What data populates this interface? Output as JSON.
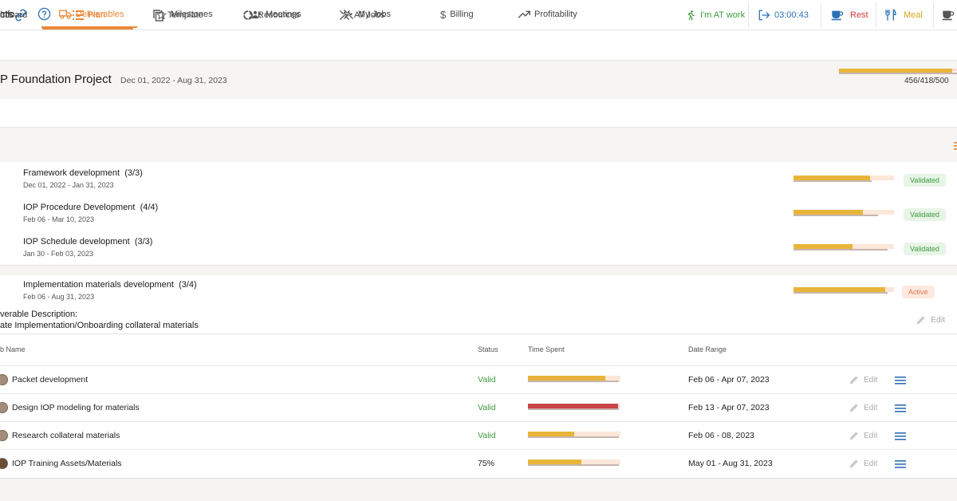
{
  "header": {
    "title": "cts",
    "status_label": "I'm AT work",
    "timer": "03:00:43",
    "rest_label": "Rest",
    "meal_label": "Meal",
    "colors": {
      "status": "#3e9a3e",
      "timer": "#2c6fb7",
      "rest": "#d03b3b",
      "meal": "#d8a51e"
    }
  },
  "tabs": [
    {
      "label": "nboard",
      "active": false
    },
    {
      "label": "Plan",
      "active": true
    },
    {
      "label": "Template",
      "active": false
    },
    {
      "label": "Resources",
      "active": false
    },
    {
      "label": "All Jobs",
      "active": false
    }
  ],
  "project": {
    "title": "P Foundation Project",
    "dates": "Dec 01, 2022 - Aug 31, 2023",
    "counts": "456/418/500"
  },
  "subtabs": [
    {
      "label": "Info",
      "active": false
    },
    {
      "label": "Deliverables",
      "active": true
    },
    {
      "label": "Milestones",
      "active": false
    },
    {
      "label": "Meetings",
      "active": false
    },
    {
      "label": "My Jobs",
      "active": false
    },
    {
      "label": "Billing",
      "active": false
    },
    {
      "label": "Profitability",
      "active": false
    }
  ],
  "deliverables": [
    {
      "name": "Framework development",
      "count": "(3/3)",
      "dates": "Dec 01, 2022 - Jan 31, 2023",
      "status": "Validated",
      "progress": 0.76,
      "secondary": 0.78
    },
    {
      "name": "IOP Procedure Development",
      "count": "(4/4)",
      "dates": "Feb 06 - Mar 10, 2023",
      "status": "Validated",
      "progress": 0.69,
      "secondary": 0.84
    },
    {
      "name": "IOP Schedule development",
      "count": "(3/3)",
      "dates": "Jan 30 - Feb 03, 2023",
      "status": "Validated",
      "progress": 0.59,
      "secondary": 0.94
    },
    {
      "name": "Implementation materials development",
      "count": "(3/4)",
      "dates": "Feb 06 - Aug 31, 2023",
      "status": "Active",
      "progress": 0.91,
      "secondary": 0.94
    }
  ],
  "expanded": {
    "desc_label": "verable Description:",
    "desc_text": "ate Implementation/Onboarding collateral materials",
    "edit_label": "Edit"
  },
  "jobs_table": {
    "headers": {
      "name": "b Name",
      "status": "Status",
      "time": "Time Spent",
      "range": "Date Range"
    },
    "rows": [
      {
        "name": "Packet development",
        "status": "Valid",
        "range": "Feb 06 - Apr 07, 2023",
        "edit": "Edit",
        "progress": 0.84,
        "bar_color": "#e8b53a"
      },
      {
        "name": "Design IOP modeling for materials",
        "status": "Valid",
        "range": "Feb 13 - Apr 07, 2023",
        "edit": "Edit",
        "progress": 0.97,
        "bar_color": "#c9454a"
      },
      {
        "name": "Research collateral materials",
        "status": "Valid",
        "range": "Feb 06 - 08, 2023",
        "edit": "Edit",
        "progress": 0.5,
        "bar_color": "#e8b53a"
      },
      {
        "name": "IOP Training Assets/Materials",
        "status": "75%",
        "range": "May 01 - Aug 31, 2023",
        "edit": "Edit",
        "progress": 0.58,
        "bar_color": "#e8b53a"
      }
    ]
  },
  "project_progress": 0.96
}
